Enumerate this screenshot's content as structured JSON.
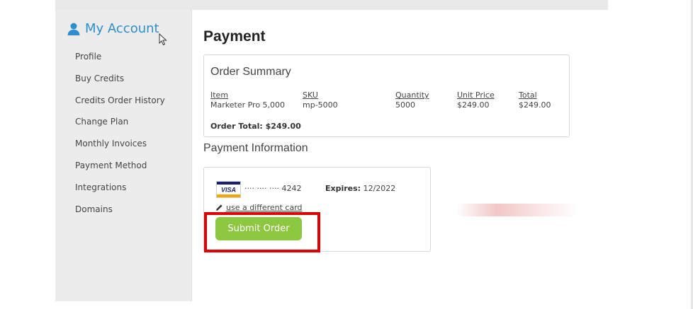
{
  "sidebar": {
    "title": "My Account",
    "items": [
      {
        "label": "Profile"
      },
      {
        "label": "Buy Credits"
      },
      {
        "label": "Credits Order History"
      },
      {
        "label": "Change Plan"
      },
      {
        "label": "Monthly Invoices"
      },
      {
        "label": "Payment Method"
      },
      {
        "label": "Integrations"
      },
      {
        "label": "Domains"
      }
    ]
  },
  "main": {
    "title": "Payment",
    "order_summary": {
      "title": "Order Summary",
      "columns": [
        "Item",
        "SKU",
        "Quantity",
        "Unit Price",
        "Total"
      ],
      "row": [
        "Marketer Pro 5,000",
        "mp-5000",
        "5000",
        "$249.00",
        "$249.00"
      ],
      "total_label": "Order Total: $249.00"
    },
    "payment_info": {
      "title": "Payment Information",
      "card_brand": "VISA",
      "card_number": "···· ···· ···· 4242",
      "expires_label": "Expires:",
      "expires_value": "12/2022",
      "change_card_label": "use a different card",
      "submit_label": "Submit Order"
    }
  },
  "colors": {
    "accent": "#2a8fd1",
    "submit": "#8dc63f",
    "highlight": "#e00000"
  },
  "icons": {
    "account": "user-icon",
    "change_card": "pencil-icon",
    "card": "visa-card-icon",
    "pointer": "cursor-icon"
  }
}
